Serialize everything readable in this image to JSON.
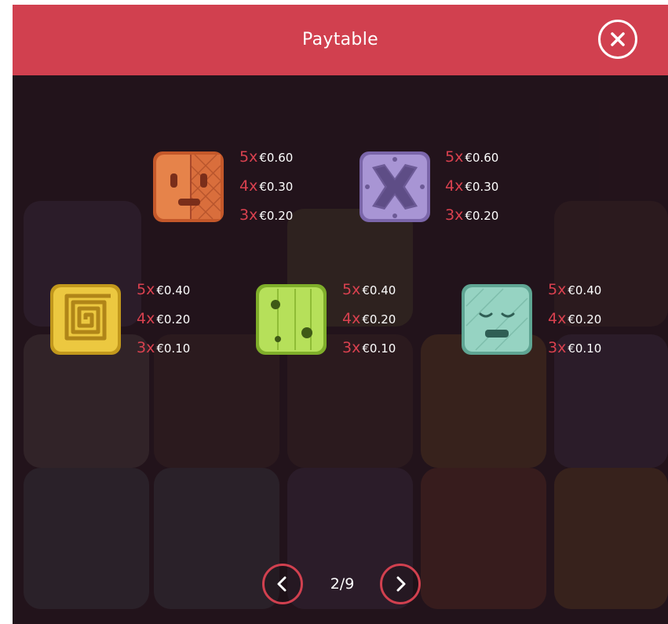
{
  "header": {
    "title": "Paytable"
  },
  "symbols": [
    {
      "name": "orange-face-block",
      "color": "#e07a3c",
      "payouts": [
        {
          "mult": "5x",
          "value": "€0.60"
        },
        {
          "mult": "4x",
          "value": "€0.30"
        },
        {
          "mult": "3x",
          "value": "€0.20"
        }
      ]
    },
    {
      "name": "purple-x-block",
      "color": "#9a86c8",
      "payouts": [
        {
          "mult": "5x",
          "value": "€0.60"
        },
        {
          "mult": "4x",
          "value": "€0.30"
        },
        {
          "mult": "3x",
          "value": "€0.20"
        }
      ]
    },
    {
      "name": "yellow-spiral-block",
      "color": "#e8c53a",
      "payouts": [
        {
          "mult": "5x",
          "value": "€0.40"
        },
        {
          "mult": "4x",
          "value": "€0.20"
        },
        {
          "mult": "3x",
          "value": "€0.10"
        }
      ]
    },
    {
      "name": "green-dice-block",
      "color": "#a9d94a",
      "payouts": [
        {
          "mult": "5x",
          "value": "€0.40"
        },
        {
          "mult": "4x",
          "value": "€0.20"
        },
        {
          "mult": "3x",
          "value": "€0.10"
        }
      ]
    },
    {
      "name": "teal-sleeping-face-block",
      "color": "#8fd0bd",
      "payouts": [
        {
          "mult": "5x",
          "value": "€0.40"
        },
        {
          "mult": "4x",
          "value": "€0.20"
        },
        {
          "mult": "3x",
          "value": "€0.10"
        }
      ]
    }
  ],
  "pager": {
    "current": "2/9"
  },
  "icons": {
    "close": "close-icon",
    "prev": "chevron-left-icon",
    "next": "chevron-right-icon"
  },
  "colors": {
    "accent": "#d1404f",
    "multiplier": "#d9414f",
    "background": "#2a1820"
  }
}
